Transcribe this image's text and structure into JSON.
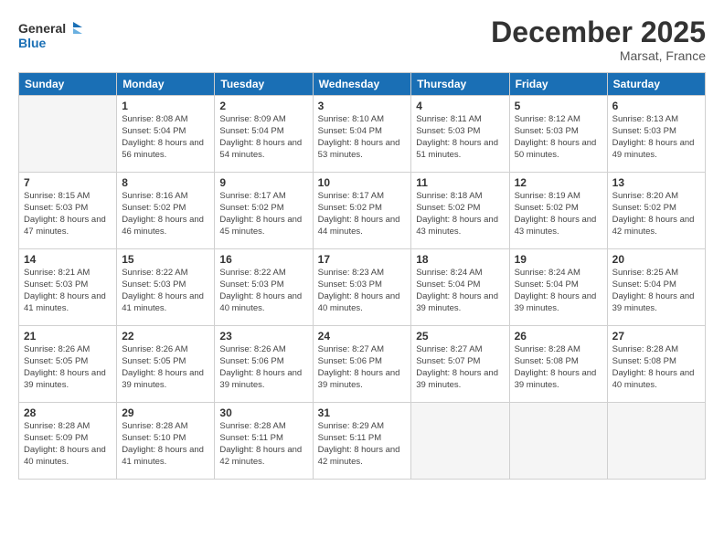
{
  "header": {
    "logo_general": "General",
    "logo_blue": "Blue",
    "month_title": "December 2025",
    "location": "Marsat, France"
  },
  "weekdays": [
    "Sunday",
    "Monday",
    "Tuesday",
    "Wednesday",
    "Thursday",
    "Friday",
    "Saturday"
  ],
  "weeks": [
    [
      {
        "day": "",
        "info": ""
      },
      {
        "day": "1",
        "info": "Sunrise: 8:08 AM\nSunset: 5:04 PM\nDaylight: 8 hours\nand 56 minutes."
      },
      {
        "day": "2",
        "info": "Sunrise: 8:09 AM\nSunset: 5:04 PM\nDaylight: 8 hours\nand 54 minutes."
      },
      {
        "day": "3",
        "info": "Sunrise: 8:10 AM\nSunset: 5:04 PM\nDaylight: 8 hours\nand 53 minutes."
      },
      {
        "day": "4",
        "info": "Sunrise: 8:11 AM\nSunset: 5:03 PM\nDaylight: 8 hours\nand 51 minutes."
      },
      {
        "day": "5",
        "info": "Sunrise: 8:12 AM\nSunset: 5:03 PM\nDaylight: 8 hours\nand 50 minutes."
      },
      {
        "day": "6",
        "info": "Sunrise: 8:13 AM\nSunset: 5:03 PM\nDaylight: 8 hours\nand 49 minutes."
      }
    ],
    [
      {
        "day": "7",
        "info": "Sunrise: 8:15 AM\nSunset: 5:03 PM\nDaylight: 8 hours\nand 47 minutes."
      },
      {
        "day": "8",
        "info": "Sunrise: 8:16 AM\nSunset: 5:02 PM\nDaylight: 8 hours\nand 46 minutes."
      },
      {
        "day": "9",
        "info": "Sunrise: 8:17 AM\nSunset: 5:02 PM\nDaylight: 8 hours\nand 45 minutes."
      },
      {
        "day": "10",
        "info": "Sunrise: 8:17 AM\nSunset: 5:02 PM\nDaylight: 8 hours\nand 44 minutes."
      },
      {
        "day": "11",
        "info": "Sunrise: 8:18 AM\nSunset: 5:02 PM\nDaylight: 8 hours\nand 43 minutes."
      },
      {
        "day": "12",
        "info": "Sunrise: 8:19 AM\nSunset: 5:02 PM\nDaylight: 8 hours\nand 43 minutes."
      },
      {
        "day": "13",
        "info": "Sunrise: 8:20 AM\nSunset: 5:02 PM\nDaylight: 8 hours\nand 42 minutes."
      }
    ],
    [
      {
        "day": "14",
        "info": "Sunrise: 8:21 AM\nSunset: 5:03 PM\nDaylight: 8 hours\nand 41 minutes."
      },
      {
        "day": "15",
        "info": "Sunrise: 8:22 AM\nSunset: 5:03 PM\nDaylight: 8 hours\nand 41 minutes."
      },
      {
        "day": "16",
        "info": "Sunrise: 8:22 AM\nSunset: 5:03 PM\nDaylight: 8 hours\nand 40 minutes."
      },
      {
        "day": "17",
        "info": "Sunrise: 8:23 AM\nSunset: 5:03 PM\nDaylight: 8 hours\nand 40 minutes."
      },
      {
        "day": "18",
        "info": "Sunrise: 8:24 AM\nSunset: 5:04 PM\nDaylight: 8 hours\nand 39 minutes."
      },
      {
        "day": "19",
        "info": "Sunrise: 8:24 AM\nSunset: 5:04 PM\nDaylight: 8 hours\nand 39 minutes."
      },
      {
        "day": "20",
        "info": "Sunrise: 8:25 AM\nSunset: 5:04 PM\nDaylight: 8 hours\nand 39 minutes."
      }
    ],
    [
      {
        "day": "21",
        "info": "Sunrise: 8:26 AM\nSunset: 5:05 PM\nDaylight: 8 hours\nand 39 minutes."
      },
      {
        "day": "22",
        "info": "Sunrise: 8:26 AM\nSunset: 5:05 PM\nDaylight: 8 hours\nand 39 minutes."
      },
      {
        "day": "23",
        "info": "Sunrise: 8:26 AM\nSunset: 5:06 PM\nDaylight: 8 hours\nand 39 minutes."
      },
      {
        "day": "24",
        "info": "Sunrise: 8:27 AM\nSunset: 5:06 PM\nDaylight: 8 hours\nand 39 minutes."
      },
      {
        "day": "25",
        "info": "Sunrise: 8:27 AM\nSunset: 5:07 PM\nDaylight: 8 hours\nand 39 minutes."
      },
      {
        "day": "26",
        "info": "Sunrise: 8:28 AM\nSunset: 5:08 PM\nDaylight: 8 hours\nand 39 minutes."
      },
      {
        "day": "27",
        "info": "Sunrise: 8:28 AM\nSunset: 5:08 PM\nDaylight: 8 hours\nand 40 minutes."
      }
    ],
    [
      {
        "day": "28",
        "info": "Sunrise: 8:28 AM\nSunset: 5:09 PM\nDaylight: 8 hours\nand 40 minutes."
      },
      {
        "day": "29",
        "info": "Sunrise: 8:28 AM\nSunset: 5:10 PM\nDaylight: 8 hours\nand 41 minutes."
      },
      {
        "day": "30",
        "info": "Sunrise: 8:28 AM\nSunset: 5:11 PM\nDaylight: 8 hours\nand 42 minutes."
      },
      {
        "day": "31",
        "info": "Sunrise: 8:29 AM\nSunset: 5:11 PM\nDaylight: 8 hours\nand 42 minutes."
      },
      {
        "day": "",
        "info": ""
      },
      {
        "day": "",
        "info": ""
      },
      {
        "day": "",
        "info": ""
      }
    ]
  ]
}
